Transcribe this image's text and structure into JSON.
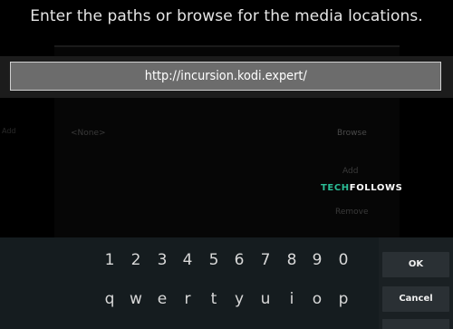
{
  "dialog": {
    "title": "Enter the paths or browse for the media locations."
  },
  "url_input": {
    "value": "http://incursion.kodi.expert/"
  },
  "background": {
    "none_label": "<None>",
    "browse_label": "Browse",
    "add_label": "Add",
    "remove_label": "Remove",
    "left_label": "Add"
  },
  "watermark": {
    "part1": "TECH",
    "part2": "FOLLOWS"
  },
  "keyboard": {
    "row1": [
      "1",
      "2",
      "3",
      "4",
      "5",
      "6",
      "7",
      "8",
      "9",
      "0"
    ],
    "row2": [
      "q",
      "w",
      "e",
      "r",
      "t",
      "y",
      "u",
      "i",
      "o",
      "p"
    ],
    "ok_label": "OK",
    "cancel_label": "Cancel"
  },
  "colors": {
    "background": "#000000",
    "url_field_bg": "#6c6c6c",
    "keyboard_bg": "#151c1f",
    "watermark_accent": "#2bbd96"
  }
}
